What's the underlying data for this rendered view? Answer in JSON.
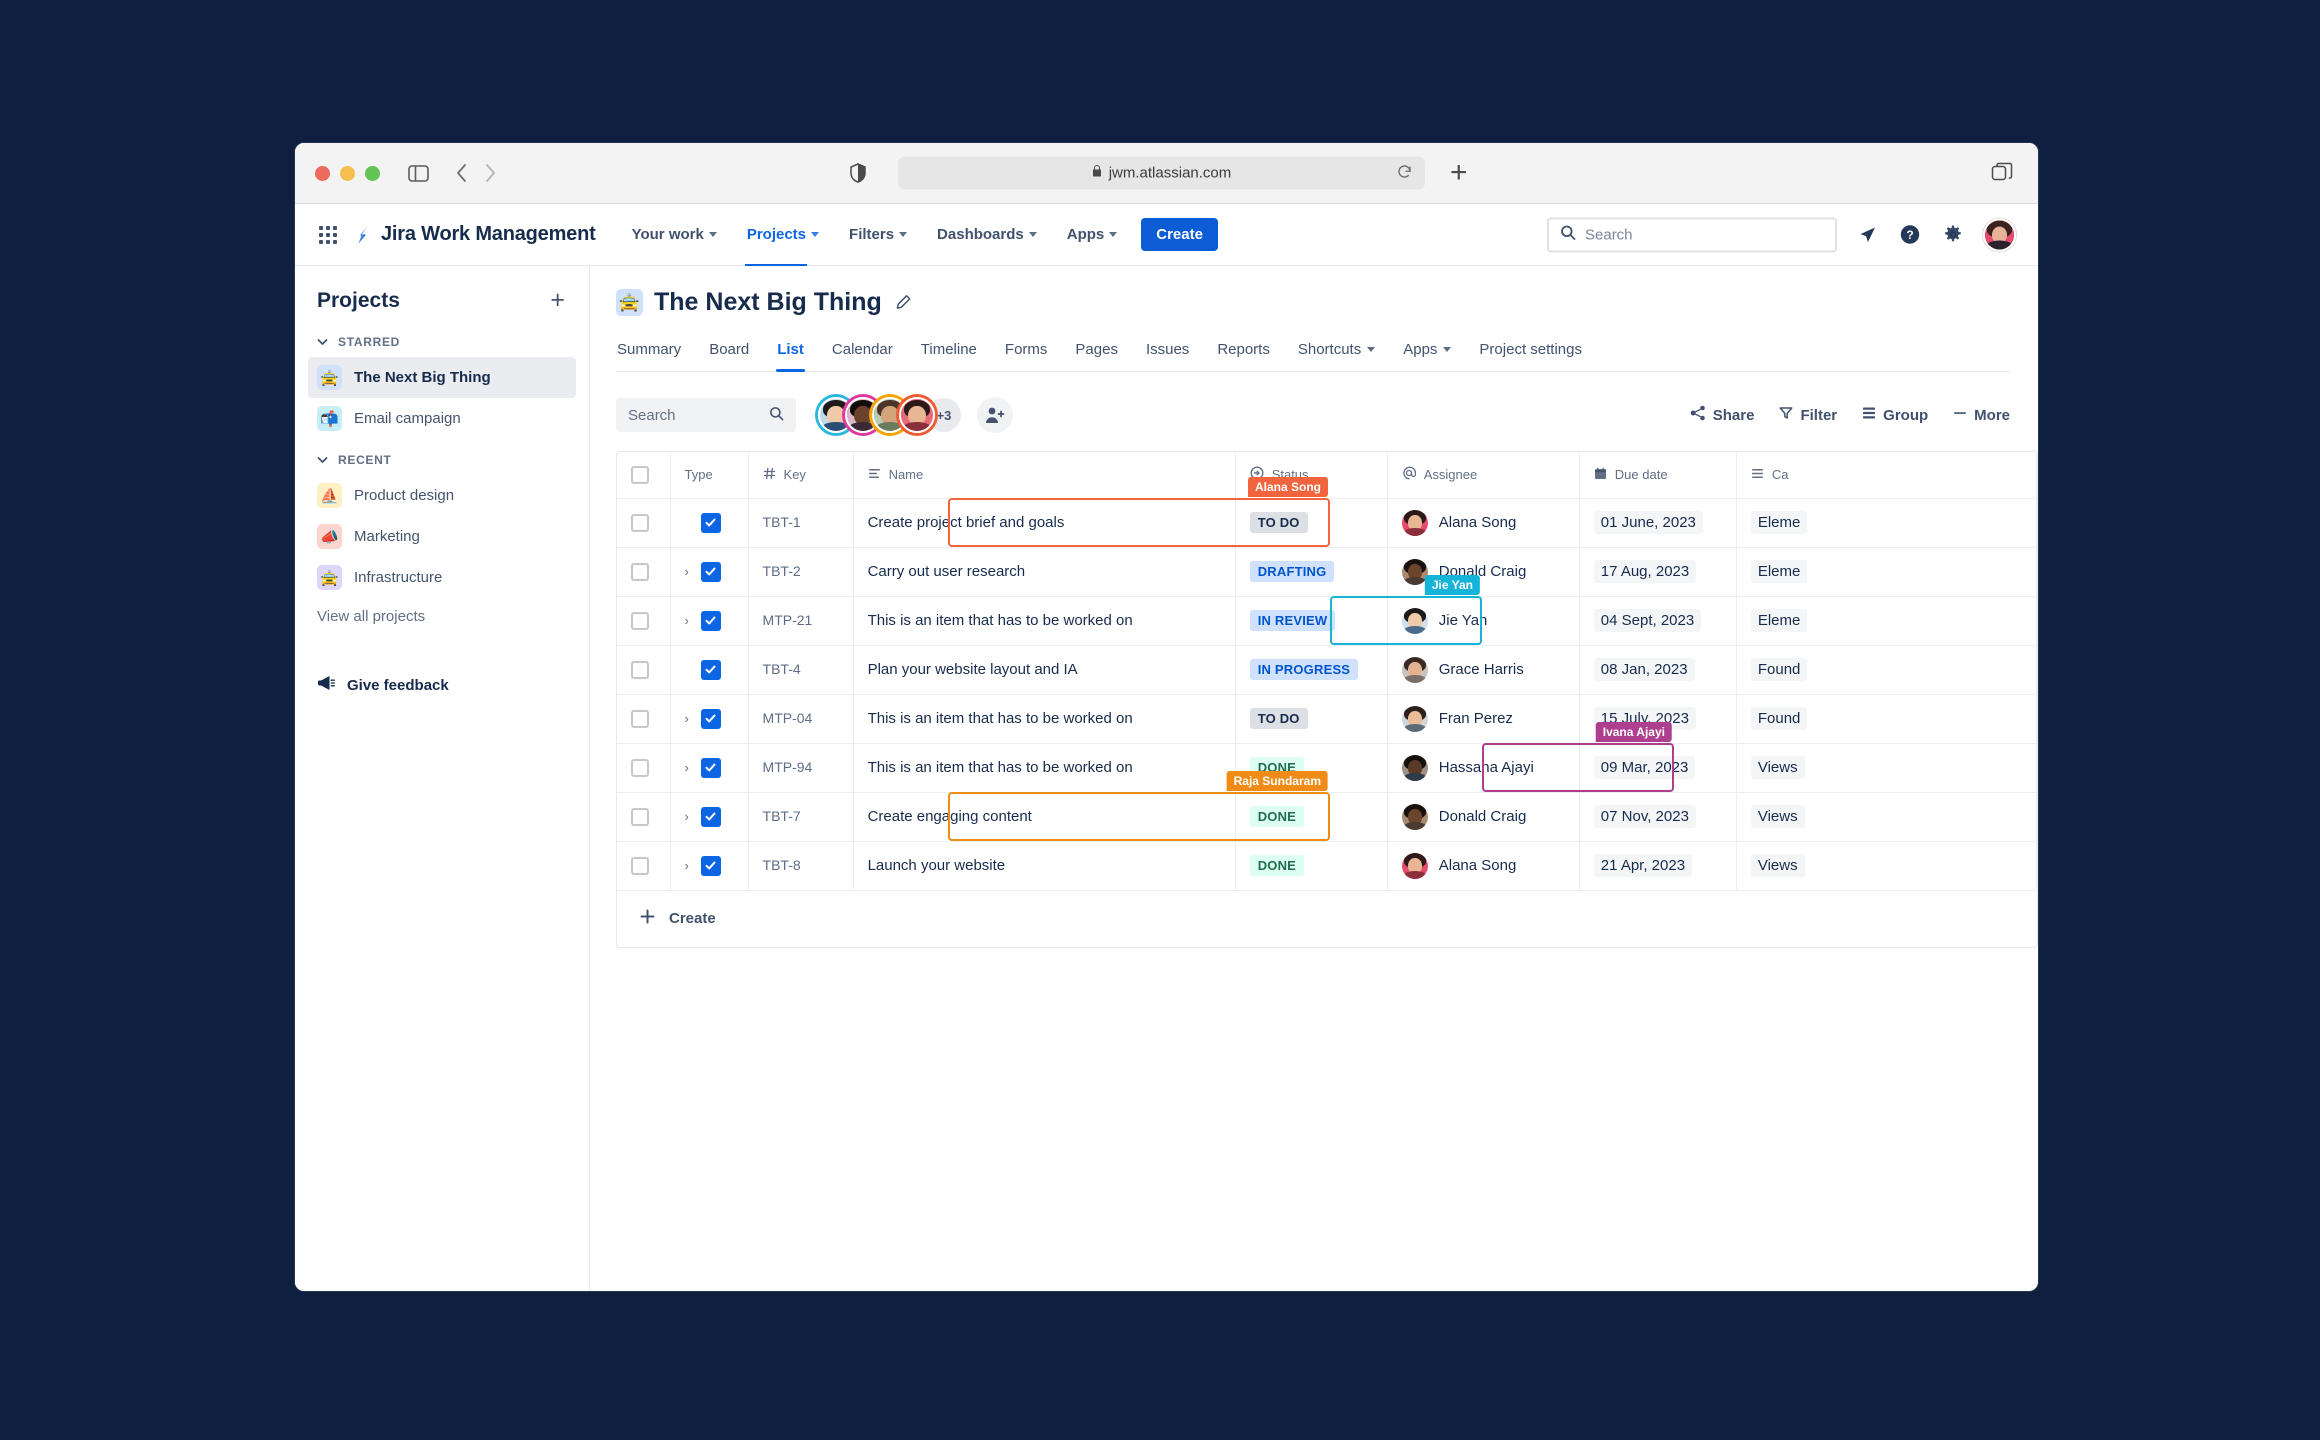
{
  "browser": {
    "url": "jwm.atlassian.com",
    "lock_icon": "lock-icon",
    "reload_icon": "reload-icon",
    "new_tab_icon": "plus-icon",
    "tabs_overview_icon": "tabs-icon",
    "shield_icon": "shield-icon",
    "sidebar_icon": "sidebar-toggle-icon",
    "back_icon": "chevron-left-icon",
    "forward_icon": "chevron-right-icon"
  },
  "topnav": {
    "app_switcher_icon": "apps-grid-icon",
    "brand": "Jira Work Management",
    "items": [
      {
        "label": "Your work",
        "has_caret": true,
        "active": false
      },
      {
        "label": "Projects",
        "has_caret": true,
        "active": true
      },
      {
        "label": "Filters",
        "has_caret": true,
        "active": false
      },
      {
        "label": "Dashboards",
        "has_caret": true,
        "active": false
      },
      {
        "label": "Apps",
        "has_caret": true,
        "active": false
      }
    ],
    "create_label": "Create",
    "search_placeholder": "Search",
    "notifications_icon": "notifications-icon",
    "help_icon": "help-icon",
    "settings_icon": "gear-icon",
    "profile_icon": "avatar"
  },
  "sidebar": {
    "title": "Projects",
    "add_icon": "plus-icon",
    "groups": [
      {
        "label": "STARRED",
        "items": [
          {
            "label": "The Next Big Thing",
            "emoji": "🚖",
            "tone": "em-blue",
            "active": true
          },
          {
            "label": "Email campaign",
            "emoji": "📬",
            "tone": "em-cyan",
            "active": false
          }
        ]
      },
      {
        "label": "RECENT",
        "items": [
          {
            "label": "Product design",
            "emoji": "⛵",
            "tone": "em-yellow",
            "active": false
          },
          {
            "label": "Marketing",
            "emoji": "📣",
            "tone": "em-red",
            "active": false
          },
          {
            "label": "Infrastructure",
            "emoji": "🚖",
            "tone": "em-purple",
            "active": false
          }
        ]
      }
    ],
    "view_all": "View all projects",
    "feedback": "Give feedback",
    "feedback_icon": "megaphone-icon"
  },
  "project": {
    "emoji": "🚖",
    "title": "The Next Big Thing",
    "edit_icon": "edit-pencil-icon",
    "tabs": [
      {
        "label": "Summary",
        "active": false,
        "has_caret": false
      },
      {
        "label": "Board",
        "active": false,
        "has_caret": false
      },
      {
        "label": "List",
        "active": true,
        "has_caret": false
      },
      {
        "label": "Calendar",
        "active": false,
        "has_caret": false
      },
      {
        "label": "Timeline",
        "active": false,
        "has_caret": false
      },
      {
        "label": "Forms",
        "active": false,
        "has_caret": false
      },
      {
        "label": "Pages",
        "active": false,
        "has_caret": false
      },
      {
        "label": "Issues",
        "active": false,
        "has_caret": false
      },
      {
        "label": "Reports",
        "active": false,
        "has_caret": false
      },
      {
        "label": "Shortcuts",
        "active": false,
        "has_caret": true
      },
      {
        "label": "Apps",
        "active": false,
        "has_caret": true
      },
      {
        "label": "Project settings",
        "active": false,
        "has_caret": false
      }
    ]
  },
  "toolbar": {
    "search_placeholder": "Search",
    "search_icon": "search-icon",
    "avatar_overflow": "+3",
    "add_people_icon": "add-people-icon",
    "actions": [
      {
        "label": "Share",
        "icon": "share-icon"
      },
      {
        "label": "Filter",
        "icon": "filter-icon"
      },
      {
        "label": "Group",
        "icon": "group-icon"
      },
      {
        "label": "More",
        "icon": "more-icon"
      }
    ]
  },
  "table": {
    "columns": [
      {
        "label": "",
        "icon": "checkbox-icon",
        "key": "check"
      },
      {
        "label": "Type",
        "icon": "",
        "key": "type"
      },
      {
        "label": "Key",
        "icon": "hash-icon",
        "key": "key"
      },
      {
        "label": "Name",
        "icon": "text-lines-icon",
        "key": "name"
      },
      {
        "label": "Status",
        "icon": "status-icon",
        "key": "status"
      },
      {
        "label": "Assignee",
        "icon": "at-icon",
        "key": "assignee"
      },
      {
        "label": "Due date",
        "icon": "calendar-icon",
        "key": "due"
      },
      {
        "label": "Ca",
        "icon": "list-icon",
        "key": "category"
      }
    ],
    "rows": [
      {
        "expandable": false,
        "key": "TBT-1",
        "name": "Create project brief and goals",
        "status": "TO DO",
        "status_tone": "lz-todo",
        "assignee": "Alana Song",
        "due": "01 June, 2023",
        "category": "Eleme"
      },
      {
        "expandable": true,
        "key": "TBT-2",
        "name": "Carry out user research",
        "status": "DRAFTING",
        "status_tone": "lz-blue",
        "assignee": "Donald Craig",
        "due": "17 Aug, 2023",
        "category": "Eleme"
      },
      {
        "expandable": true,
        "key": "MTP-21",
        "name": "This is an item that has to be worked on",
        "status": "IN REVIEW",
        "status_tone": "lz-blue",
        "assignee": "Jie Yan",
        "due": "04 Sept, 2023",
        "category": "Eleme"
      },
      {
        "expandable": false,
        "key": "TBT-4",
        "name": "Plan your website layout and IA",
        "status": "IN PROGRESS",
        "status_tone": "lz-blue",
        "assignee": "Grace Harris",
        "due": "08 Jan, 2023",
        "category": "Found"
      },
      {
        "expandable": true,
        "key": "MTP-04",
        "name": "This is an item that has to be worked on",
        "status": "TO DO",
        "status_tone": "lz-todo",
        "assignee": "Fran Perez",
        "due": "15 July, 2023",
        "category": "Found"
      },
      {
        "expandable": true,
        "key": "MTP-94",
        "name": "This is an item that has to be worked on",
        "status": "DONE",
        "status_tone": "lz-done",
        "assignee": "Hassana Ajayi",
        "due": "09 Mar, 2023",
        "category": "Views"
      },
      {
        "expandable": true,
        "key": "TBT-7",
        "name": "Create engaging content",
        "status": "DONE",
        "status_tone": "lz-done",
        "assignee": "Donald Craig",
        "due": "07 Nov, 2023",
        "category": "Views"
      },
      {
        "expandable": true,
        "key": "TBT-8",
        "name": "Launch your website",
        "status": "DONE",
        "status_tone": "lz-done",
        "assignee": "Alana Song",
        "due": "21 Apr, 2023",
        "category": "Views"
      }
    ],
    "create_label": "Create",
    "create_icon": "plus-icon"
  },
  "collaborators": [
    {
      "name": "Alana Song",
      "label_tone": "cl-orange",
      "cell": "name",
      "row": 0
    },
    {
      "name": "Jie Yan",
      "label_tone": "cl-cyan",
      "cell": "status",
      "row": 2
    },
    {
      "name": "Ivana Ajayi",
      "label_tone": "cl-magenta",
      "cell": "assignee",
      "row": 5
    },
    {
      "name": "Raja Sundaram",
      "label_tone": "cl-amber",
      "cell": "name",
      "row": 6
    }
  ],
  "colors": {
    "page_background": "#0e1f40",
    "accent_blue": "#0c66e4",
    "create_button": "#0b5cd5",
    "cursor_orange": "#f1643e",
    "cursor_amber": "#ef8b16",
    "cursor_cyan": "#16b4d8",
    "cursor_magenta": "#ae3f8e",
    "done_green": "#216e4e"
  }
}
